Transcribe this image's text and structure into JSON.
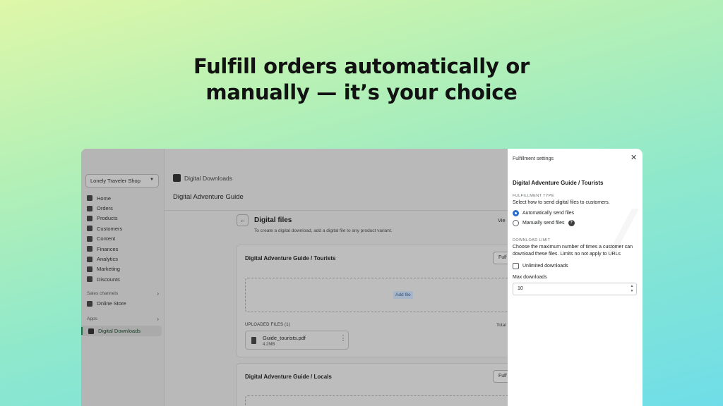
{
  "headline": {
    "line1": "Fulfill orders automatically or",
    "line2": "manually — it’s your choice"
  },
  "sidebar": {
    "shop_name": "Lonely Traveler Shop",
    "items": [
      {
        "label": "Home",
        "icon": "home-icon"
      },
      {
        "label": "Orders",
        "icon": "orders-icon"
      },
      {
        "label": "Products",
        "icon": "tag-icon"
      },
      {
        "label": "Customers",
        "icon": "person-icon"
      },
      {
        "label": "Content",
        "icon": "content-icon"
      },
      {
        "label": "Finances",
        "icon": "bank-icon"
      },
      {
        "label": "Analytics",
        "icon": "chart-icon"
      },
      {
        "label": "Marketing",
        "icon": "target-icon"
      },
      {
        "label": "Discounts",
        "icon": "discount-icon"
      }
    ],
    "sales_channels_label": "Sales channels",
    "online_store": "Online Store",
    "apps_label": "Apps",
    "active_app": "Digital Downloads"
  },
  "main": {
    "app_name": "Digital Downloads",
    "page_title": "Digital Adventure Guide",
    "section_title": "Digital files",
    "section_subtitle": "To create a digital download, add a digital file to any product variant.",
    "view_link": "Vie",
    "cards": [
      {
        "title": "Digital Adventure Guide / Tourists",
        "button": "Fulf",
        "add_file": "Add file",
        "uploaded_label": "UPLOADED FILES (1)",
        "total_label": "Total",
        "file": {
          "name": "Guide_tourists.pdf",
          "size": "4.2MB"
        }
      },
      {
        "title": "Digital Adventure Guide / Locals",
        "button": "Fulf"
      }
    ]
  },
  "panel": {
    "header": "Fulfillment settings",
    "title": "Digital Adventure Guide / Tourists",
    "fulfillment_type": {
      "label": "FULFILLMENT TYPE",
      "description": "Select how to send digital files to customers.",
      "options": [
        "Automatically send files",
        "Manually send files"
      ],
      "selected": "Automatically send files"
    },
    "download_limit": {
      "label": "DOWNLOAD LIMIT",
      "description": "Choose the maximum number of times a customer can download these files. Limits no not apply to URLs",
      "unlimited_label": "Unlimited downloads",
      "unlimited_checked": false,
      "max_label": "Max downloads",
      "max_value": "10"
    }
  },
  "colors": {
    "accent": "#2c6ecb",
    "active_nav": "#2a6a45"
  }
}
